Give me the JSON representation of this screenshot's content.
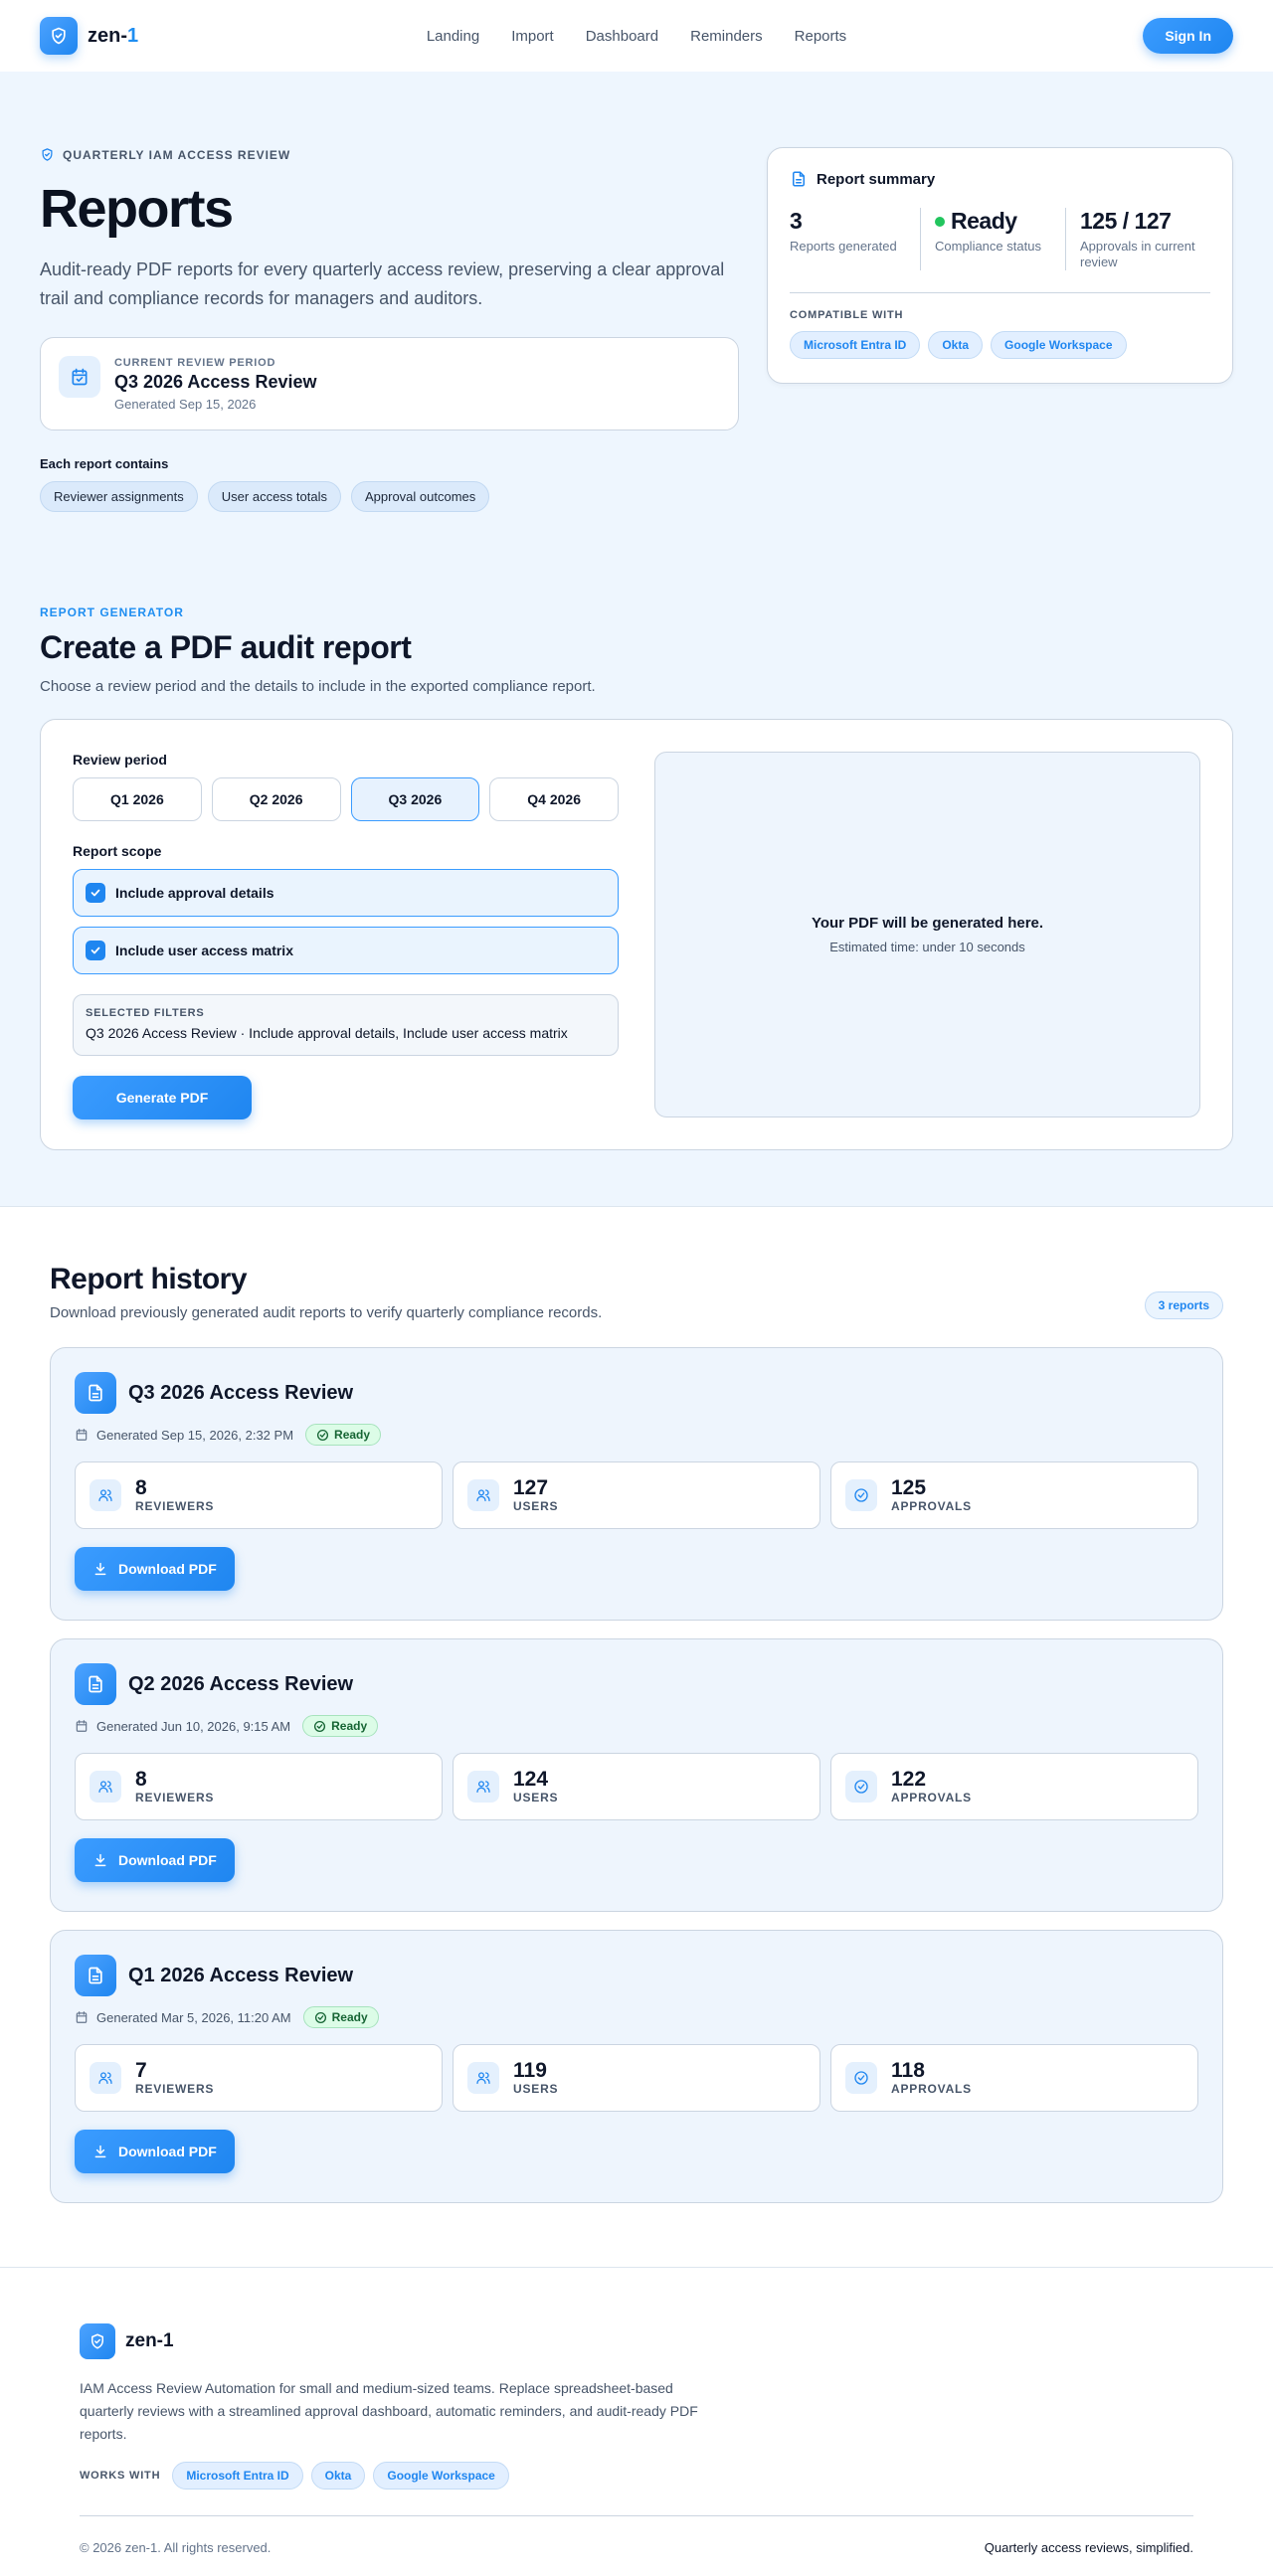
{
  "nav": {
    "brand_prefix": "zen-",
    "brand_suffix": "1",
    "links": [
      "Landing",
      "Import",
      "Dashboard",
      "Reminders",
      "Reports"
    ],
    "signin": "Sign In"
  },
  "hero": {
    "eyebrow": "QUARTERLY IAM ACCESS REVIEW",
    "title": "Reports",
    "description": "Audit-ready PDF reports for every quarterly access review, preserving a clear approval trail and compliance records for managers and auditors.",
    "period_label": "CURRENT REVIEW PERIOD",
    "period_title": "Q3 2026 Access Review",
    "period_date": "Generated Sep 15, 2026",
    "contains_label": "Each report contains",
    "contains": [
      "Reviewer assignments",
      "User access totals",
      "Approval outcomes"
    ]
  },
  "summary": {
    "title": "Report summary",
    "stats": [
      {
        "value": "3",
        "label": "Reports generated"
      },
      {
        "value": "Ready",
        "label": "Compliance status"
      },
      {
        "value": "125 / 127",
        "label": "Approvals in current review"
      }
    ],
    "compat_label": "COMPATIBLE WITH",
    "compat": [
      "Microsoft Entra ID",
      "Okta",
      "Google Workspace"
    ]
  },
  "generator": {
    "eyebrow": "REPORT GENERATOR",
    "title": "Create a PDF audit report",
    "subtitle": "Choose a review period and the details to include in the exported compliance report.",
    "period_label": "Review period",
    "periods": [
      "Q1 2026",
      "Q2 2026",
      "Q3 2026",
      "Q4 2026"
    ],
    "selected_period": "Q3 2026",
    "scope_label": "Report scope",
    "scope": [
      "Include approval details",
      "Include user access matrix"
    ],
    "filters_label": "SELECTED FILTERS",
    "filters_value": "Q3 2026 Access Review · Include approval details, Include user access matrix",
    "button": "Generate PDF",
    "preview_title": "Your PDF will be generated here.",
    "preview_sub": "Estimated time: under 10 seconds"
  },
  "history": {
    "title": "Report history",
    "subtitle": "Download previously generated audit reports to verify quarterly compliance records.",
    "count": "3 reports",
    "reports": [
      {
        "title": "Q3 2026 Access Review",
        "generated": "Generated Sep 15, 2026, 2:32 PM",
        "status": "Ready",
        "metrics": [
          {
            "value": "8",
            "label": "REVIEWERS"
          },
          {
            "value": "127",
            "label": "USERS"
          },
          {
            "value": "125",
            "label": "APPROVALS"
          }
        ],
        "button": "Download PDF"
      },
      {
        "title": "Q2 2026 Access Review",
        "generated": "Generated Jun 10, 2026, 9:15 AM",
        "status": "Ready",
        "metrics": [
          {
            "value": "8",
            "label": "REVIEWERS"
          },
          {
            "value": "124",
            "label": "USERS"
          },
          {
            "value": "122",
            "label": "APPROVALS"
          }
        ],
        "button": "Download PDF"
      },
      {
        "title": "Q1 2026 Access Review",
        "generated": "Generated Mar 5, 2026, 11:20 AM",
        "status": "Ready",
        "metrics": [
          {
            "value": "7",
            "label": "REVIEWERS"
          },
          {
            "value": "119",
            "label": "USERS"
          },
          {
            "value": "118",
            "label": "APPROVALS"
          }
        ],
        "button": "Download PDF"
      }
    ]
  },
  "footer": {
    "brand": "zen-1",
    "description": "IAM Access Review Automation for small and medium-sized teams. Replace spreadsheet-based quarterly reviews with a streamlined approval dashboard, automatic reminders, and audit-ready PDF reports.",
    "works_label": "WORKS WITH",
    "works": [
      "Microsoft Entra ID",
      "Okta",
      "Google Workspace"
    ],
    "copyright": "© 2026 zen-1. All rights reserved.",
    "tagline": "Quarterly access reviews, simplified."
  },
  "colors": {
    "accent": "#1f86f0",
    "success": "#22c55e",
    "background": "#eef6fe"
  },
  "icons": [
    "shield-check-icon",
    "calendar-check-icon",
    "document-icon",
    "users-icon",
    "check-circle-icon",
    "download-icon",
    "checkbox-check-icon"
  ]
}
